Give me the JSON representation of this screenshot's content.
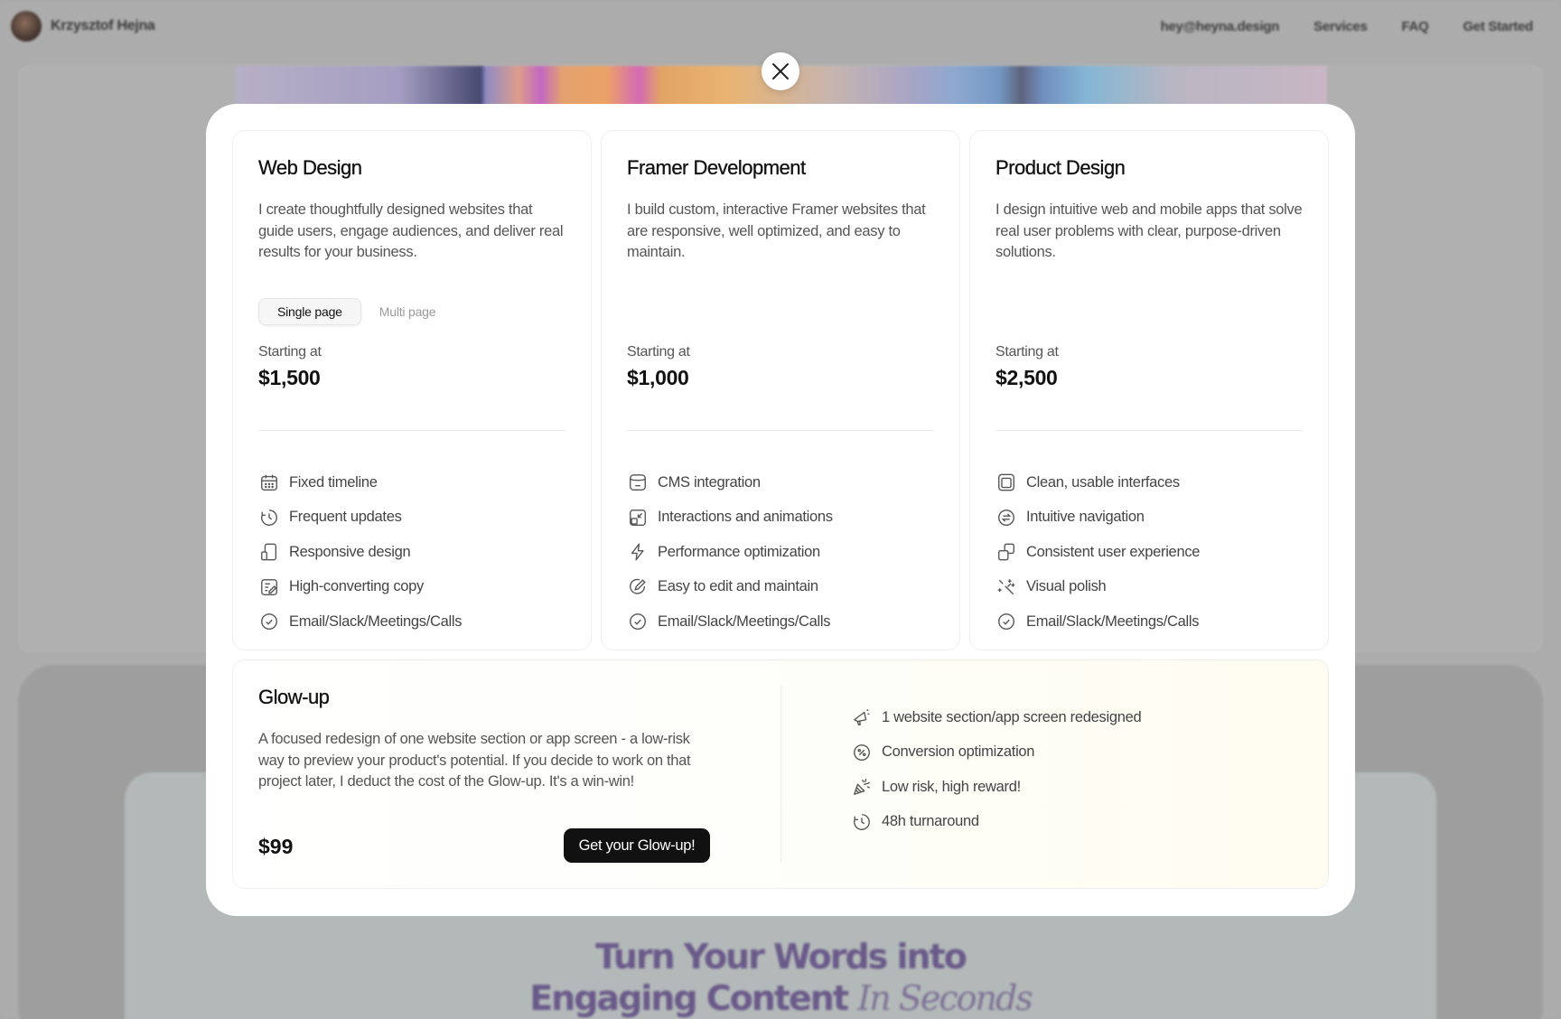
{
  "background": {
    "name": "Krzysztof Hejna",
    "nav": [
      "hey@heyna.design",
      "Services",
      "FAQ",
      "Get Started"
    ],
    "headline_line1": "Turn Your Words into",
    "headline_line2_bold": "Engaging Content",
    "headline_line2_italic": "In Seconds"
  },
  "modal": {
    "close_icon": "close-icon",
    "cards": [
      {
        "title": "Web Design",
        "description": "I create thoughtfully designed websites that guide users, engage audiences, and deliver real results for your business.",
        "toggle": {
          "options": [
            "Single page",
            "Multi page"
          ],
          "selected": "Single page"
        },
        "price_label": "Starting at",
        "price": "$1,500",
        "features": [
          {
            "icon": "calendar-icon",
            "label": "Fixed timeline"
          },
          {
            "icon": "clock-icon",
            "label": "Frequent updates"
          },
          {
            "icon": "devices-icon",
            "label": "Responsive design"
          },
          {
            "icon": "edit-note-icon",
            "label": "High-converting copy"
          },
          {
            "icon": "check-circle-icon",
            "label": "Email/Slack/Meetings/Calls"
          }
        ]
      },
      {
        "title": "Framer Development",
        "description": "I build custom, interactive Framer websites that are responsive, well optimized, and easy to maintain.",
        "price_label": "Starting at",
        "price": "$1,000",
        "features": [
          {
            "icon": "database-icon",
            "label": "CMS integration"
          },
          {
            "icon": "shrink-icon",
            "label": "Interactions and animations"
          },
          {
            "icon": "lightning-icon",
            "label": "Performance optimization"
          },
          {
            "icon": "pen-circle-icon",
            "label": "Easy to edit and maintain"
          },
          {
            "icon": "check-circle-icon",
            "label": "Email/Slack/Meetings/Calls"
          }
        ]
      },
      {
        "title": "Product Design",
        "description": "I design intuitive web and mobile apps that solve real user problems with clear, purpose-driven solutions.",
        "price_label": "Starting at",
        "price": "$2,500",
        "features": [
          {
            "icon": "window-icon",
            "label": "Clean, usable interfaces"
          },
          {
            "icon": "swap-circle-icon",
            "label": "Intuitive navigation"
          },
          {
            "icon": "stacked-squares-icon",
            "label": "Consistent user experience"
          },
          {
            "icon": "sparkle-wand-icon",
            "label": "Visual polish"
          },
          {
            "icon": "check-circle-icon",
            "label": "Email/Slack/Meetings/Calls"
          }
        ]
      }
    ],
    "glow": {
      "title": "Glow-up",
      "description": "A focused redesign of one website section or app screen - a low-risk way to preview your product's potential. If you decide to work on that project later, I deduct the cost of the Glow-up. It's a win-win!",
      "price": "$99",
      "cta": "Get your Glow-up!",
      "features": [
        {
          "icon": "megaphone-icon",
          "label": "1 website section/app screen redesigned"
        },
        {
          "icon": "discount-tag-icon",
          "label": "Conversion optimization"
        },
        {
          "icon": "party-popper-icon",
          "label": "Low risk, high reward!"
        },
        {
          "icon": "clock-icon",
          "label": "48h turnaround"
        }
      ]
    }
  }
}
